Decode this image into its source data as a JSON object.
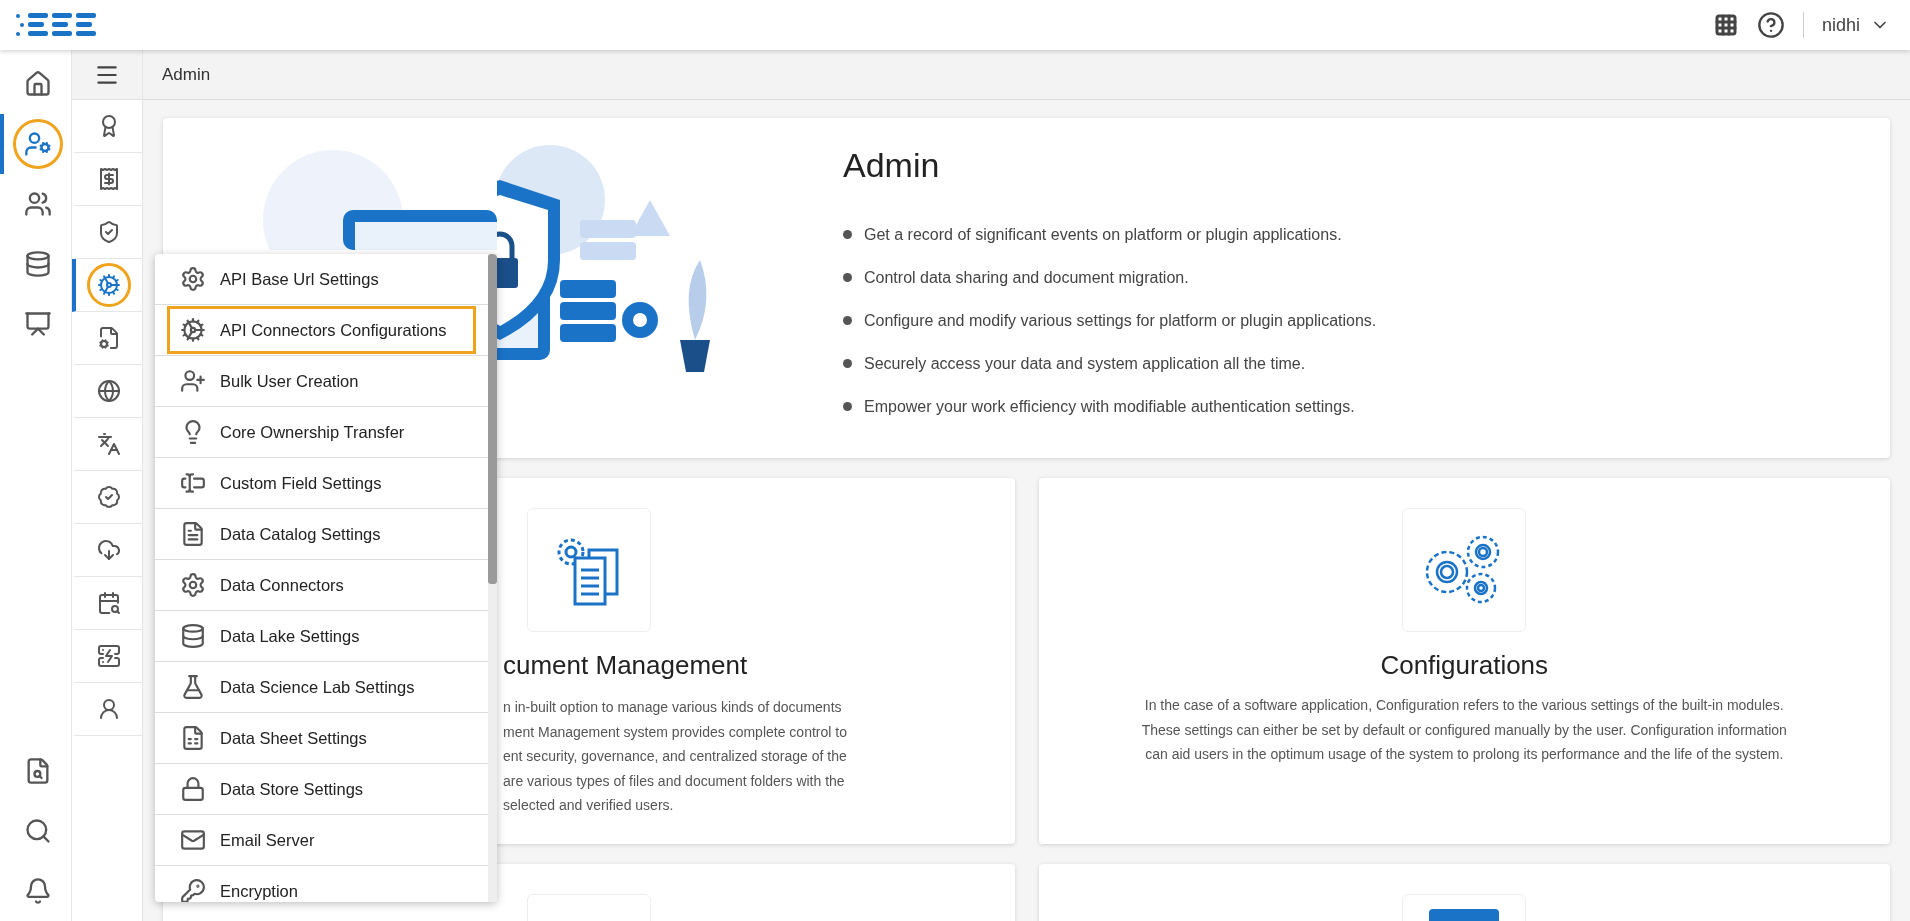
{
  "header": {
    "user": "nidhi"
  },
  "rail": {
    "top": [
      {
        "selected": false
      },
      {
        "selected": true
      },
      {
        "selected": false
      },
      {
        "selected": false
      },
      {
        "selected": false
      }
    ],
    "bottom": [
      {
        "selected": false
      },
      {
        "selected": false
      },
      {
        "selected": false
      }
    ]
  },
  "subrail": [
    {
      "selected": false
    },
    {
      "selected": false
    },
    {
      "selected": false
    },
    {
      "selected": true
    },
    {
      "selected": false
    },
    {
      "selected": false
    },
    {
      "selected": false
    },
    {
      "selected": false
    },
    {
      "selected": false
    },
    {
      "selected": false
    },
    {
      "selected": false
    },
    {
      "selected": false
    }
  ],
  "breadcrumb": "Admin",
  "hero": {
    "title": "Admin",
    "bullets": [
      "Get a record of significant events on platform or plugin applications.",
      "Control data sharing and document migration.",
      "Configure and modify various settings for platform or plugin applications.",
      "Securely access your data and system application all the time.",
      "Empower your work efficiency with modifiable authentication settings."
    ]
  },
  "cards": [
    {
      "kind": "covered",
      "title": "cument Management",
      "lines": [
        "n in-built option to manage various kinds of documents",
        "ment Management system provides complete control to",
        "ent security, governance, and centralized storage of the",
        "are various types of files and document folders with the",
        "selected and verified users."
      ]
    },
    {
      "kind": "full",
      "title": "Configurations",
      "text": "In the case of a software application, Configuration refers to the various settings of the built-in modules. These settings can either be set by default or configured manually by the user. Configuration information can aid users in the optimum usage of the system to prolong its performance and the life of the system."
    }
  ],
  "menu": {
    "items": [
      {
        "label": "API Base Url Settings",
        "selected": false
      },
      {
        "label": "API Connectors Configurations",
        "selected": true
      },
      {
        "label": "Bulk User Creation",
        "selected": false
      },
      {
        "label": "Core Ownership Transfer",
        "selected": false
      },
      {
        "label": "Custom Field Settings",
        "selected": false
      },
      {
        "label": "Data Catalog Settings",
        "selected": false
      },
      {
        "label": "Data Connectors",
        "selected": false
      },
      {
        "label": "Data Lake Settings",
        "selected": false
      },
      {
        "label": "Data Science Lab Settings",
        "selected": false
      },
      {
        "label": "Data Sheet Settings",
        "selected": false
      },
      {
        "label": "Data Store Settings",
        "selected": false
      },
      {
        "label": "Email Server",
        "selected": false
      },
      {
        "label": "Encryption",
        "selected": false
      }
    ]
  }
}
